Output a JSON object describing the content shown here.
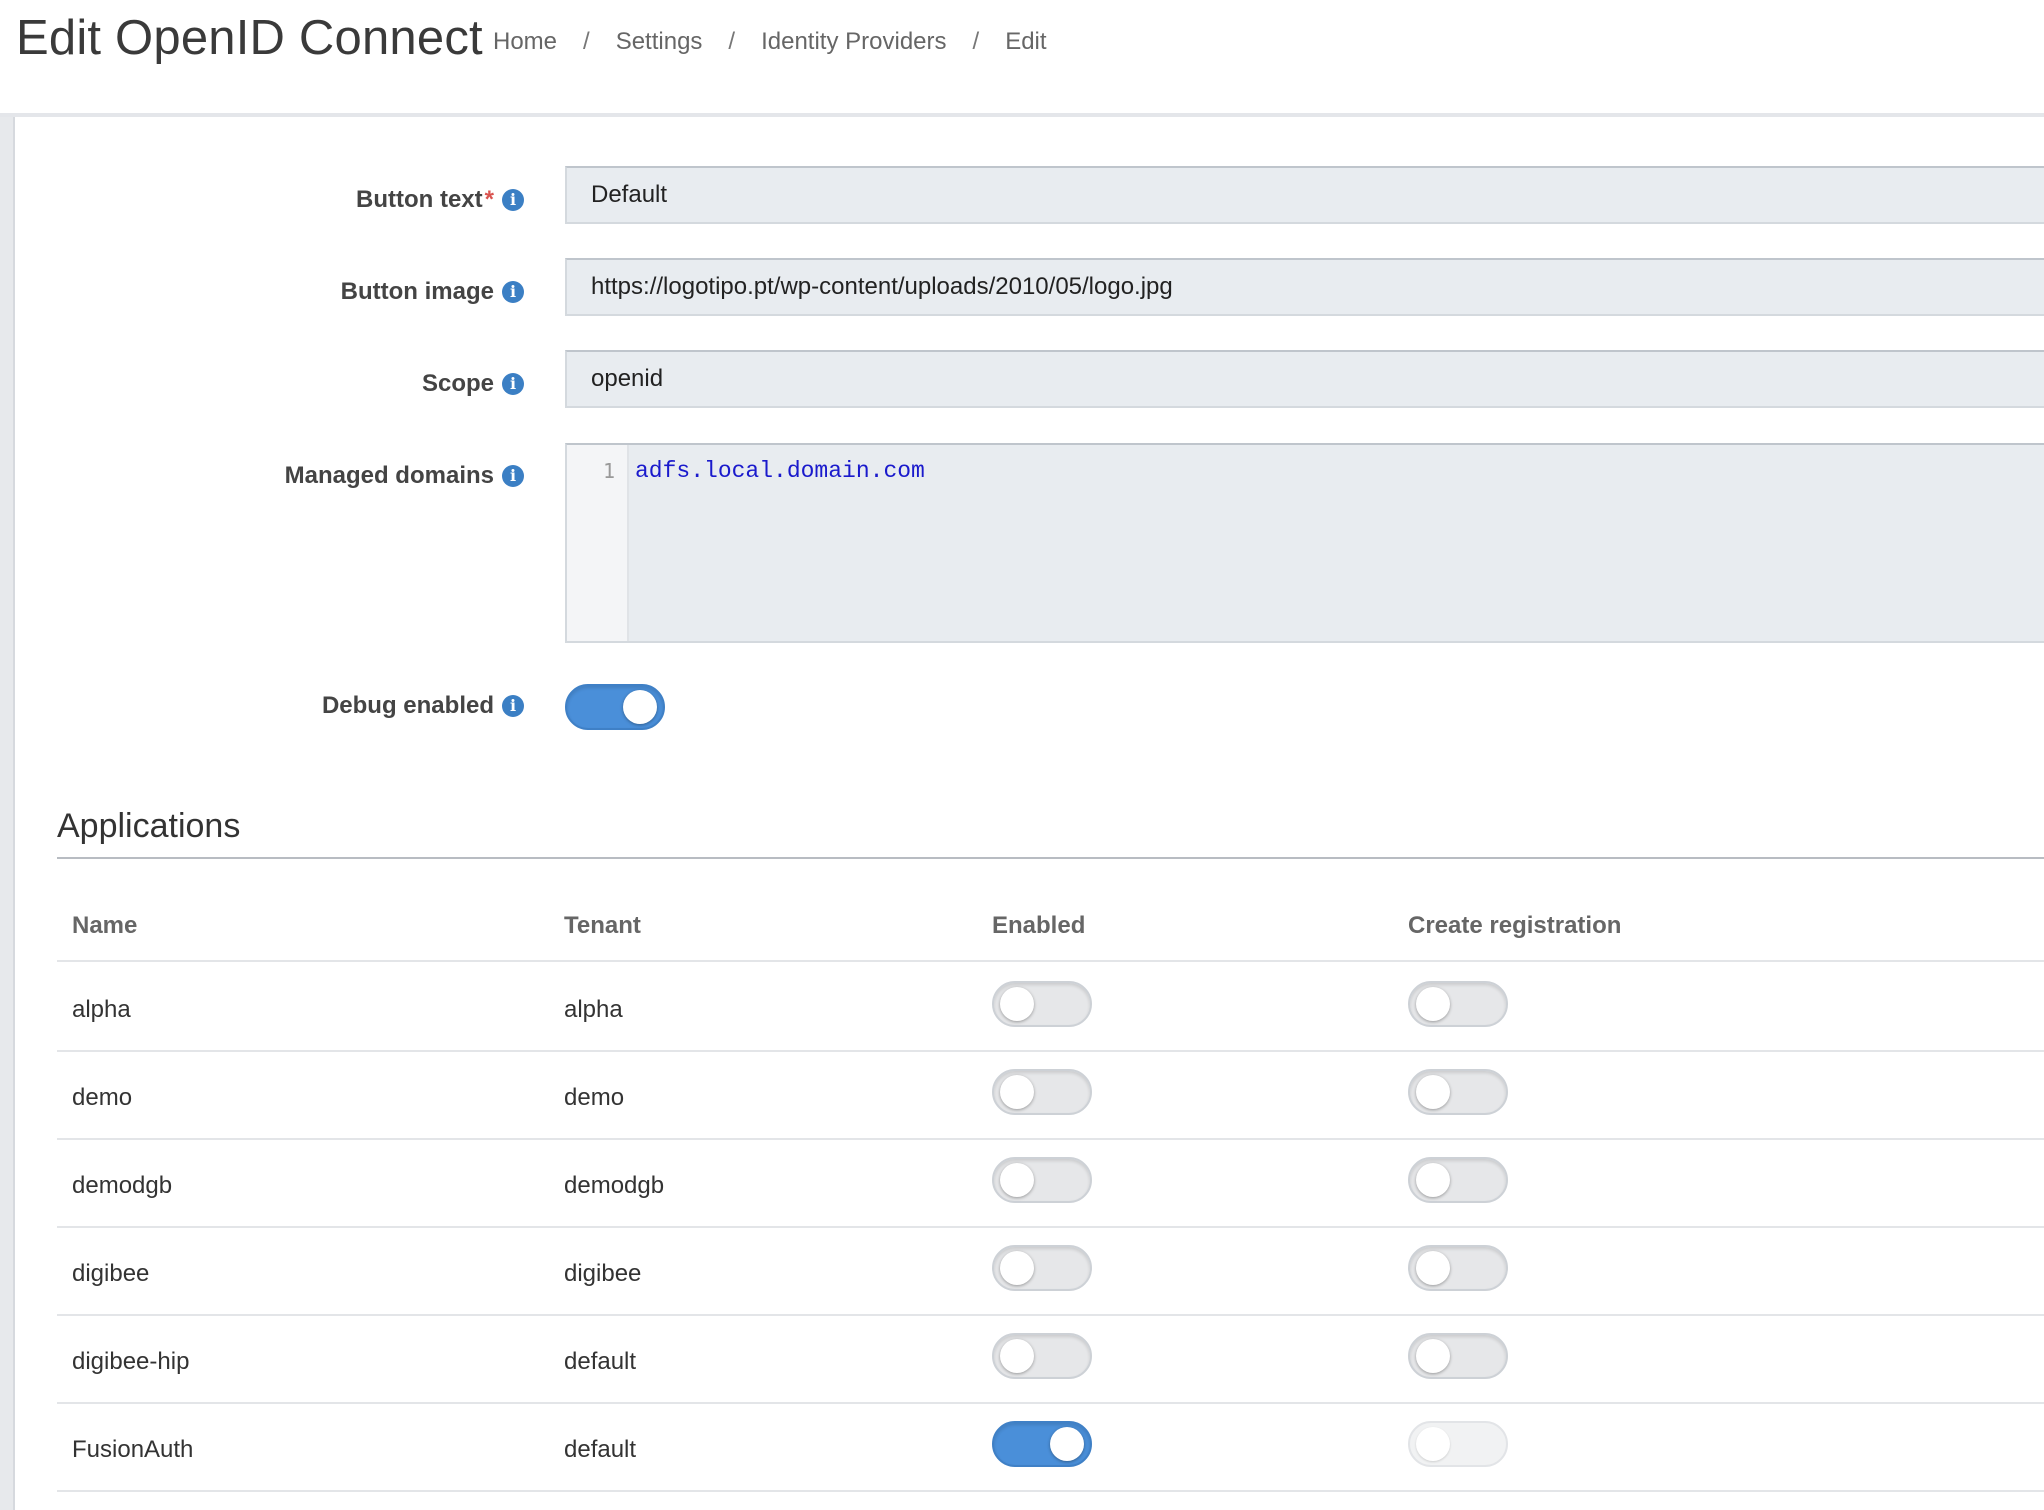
{
  "header": {
    "title": "Edit OpenID Connect",
    "breadcrumbs": [
      "Home",
      "Settings",
      "Identity Providers",
      "Edit"
    ],
    "separator": "/"
  },
  "form": {
    "button_text": {
      "label": "Button text",
      "required_mark": "*",
      "value": "Default"
    },
    "button_image": {
      "label": "Button image",
      "value": "https://logotipo.pt/wp-content/uploads/2010/05/logo.jpg"
    },
    "scope": {
      "label": "Scope",
      "value": "openid"
    },
    "managed_domains": {
      "label": "Managed domains",
      "line_number": "1",
      "value": "adfs.local.domain.com"
    },
    "debug_enabled": {
      "label": "Debug enabled",
      "on": true
    },
    "info_glyph": "i"
  },
  "applications": {
    "title": "Applications",
    "columns": [
      "Name",
      "Tenant",
      "Enabled",
      "Create registration"
    ],
    "rows": [
      {
        "name": "alpha",
        "tenant": "alpha",
        "enabled": false,
        "create_registration": false
      },
      {
        "name": "demo",
        "tenant": "demo",
        "enabled": false,
        "create_registration": false
      },
      {
        "name": "demodgb",
        "tenant": "demodgb",
        "enabled": false,
        "create_registration": false
      },
      {
        "name": "digibee",
        "tenant": "digibee",
        "enabled": false,
        "create_registration": false
      },
      {
        "name": "digibee-hip",
        "tenant": "default",
        "enabled": false,
        "create_registration": false
      },
      {
        "name": "FusionAuth",
        "tenant": "default",
        "enabled": true,
        "create_registration": false,
        "create_registration_disabled": true
      }
    ]
  },
  "colors": {
    "accent": "#4a8fd9",
    "info_icon": "#3b7fc4",
    "required": "#d9534f",
    "input_bg": "#e8ecf0",
    "code_text": "#1a1acc"
  },
  "icons": {
    "info": "info-circle-icon"
  }
}
